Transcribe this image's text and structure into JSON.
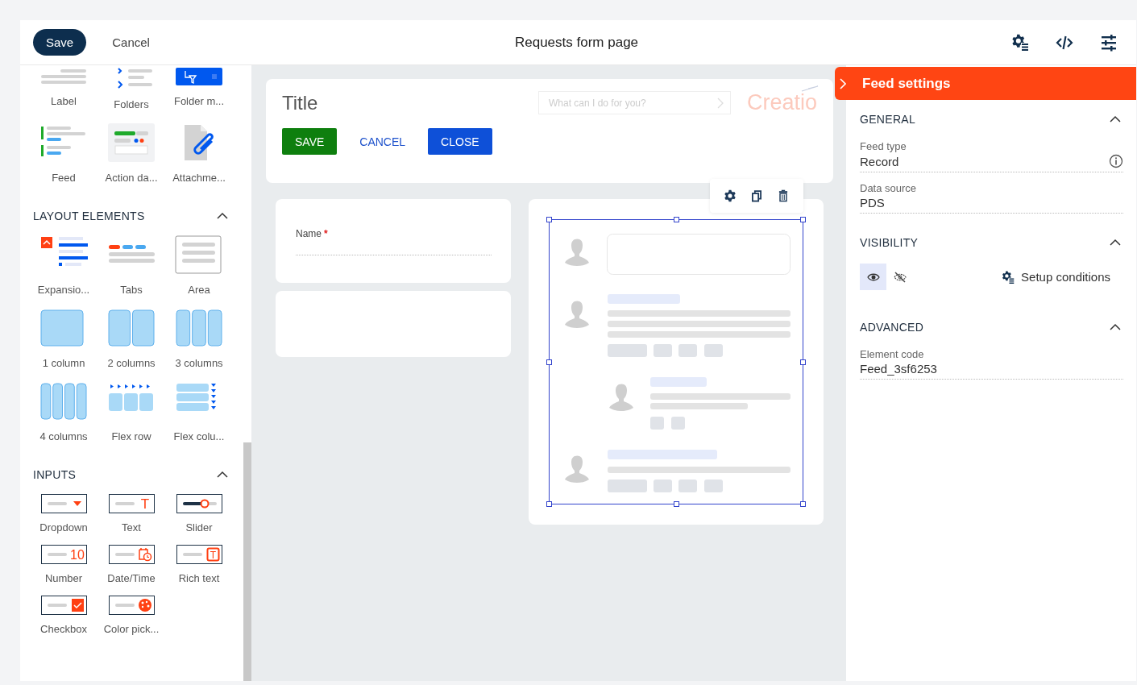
{
  "header": {
    "save": "Save",
    "cancel": "Cancel",
    "title": "Requests form page"
  },
  "palette": [
    {
      "items": [
        {
          "kind": "label",
          "label": "Label"
        },
        {
          "kind": "folders",
          "label": "Folders"
        },
        {
          "kind": "folder-manager",
          "label": "Folder m..."
        },
        {
          "kind": "feed",
          "label": "Feed"
        },
        {
          "kind": "action-dashboard",
          "label": "Action da..."
        },
        {
          "kind": "attachments",
          "label": "Attachme..."
        }
      ]
    },
    {
      "title": "LAYOUT ELEMENTS",
      "expanded": true,
      "items": [
        {
          "kind": "expansion",
          "label": "Expansio..."
        },
        {
          "kind": "tabs",
          "label": "Tabs"
        },
        {
          "kind": "area",
          "label": "Area"
        },
        {
          "kind": "columns1",
          "label": "1 column"
        },
        {
          "kind": "columns2",
          "label": "2 columns"
        },
        {
          "kind": "columns3",
          "label": "3 columns"
        },
        {
          "kind": "columns4",
          "label": "4 columns"
        },
        {
          "kind": "flex-row",
          "label": "Flex row"
        },
        {
          "kind": "flex-column",
          "label": "Flex colu..."
        }
      ]
    },
    {
      "title": "INPUTS",
      "expanded": true,
      "items": [
        {
          "kind": "dropdown",
          "label": "Dropdown"
        },
        {
          "kind": "text",
          "label": "Text",
          "glyph": "T"
        },
        {
          "kind": "slider",
          "label": "Slider"
        },
        {
          "kind": "number",
          "label": "Number",
          "glyph": "10"
        },
        {
          "kind": "datetime",
          "label": "Date/Time"
        },
        {
          "kind": "richtext",
          "label": "Rich text",
          "glyph": "T"
        },
        {
          "kind": "checkbox",
          "label": "Checkbox"
        },
        {
          "kind": "colorpicker",
          "label": "Color pick..."
        }
      ]
    }
  ],
  "page": {
    "title": "Title",
    "search_placeholder": "What can I do for you?",
    "logo": "Creatio",
    "buttons": [
      {
        "label": "SAVE",
        "kind": "green"
      },
      {
        "label": "CANCEL",
        "kind": "link"
      },
      {
        "label": "CLOSE",
        "kind": "blue"
      }
    ],
    "field": {
      "label": "Name",
      "required_mark": "*"
    }
  },
  "settings": {
    "title": "Feed settings",
    "sections": [
      {
        "title": "GENERAL",
        "expanded": true,
        "kind": "fields",
        "fields": [
          {
            "label": "Feed type",
            "value": "Record",
            "info": true
          },
          {
            "label": "Data source",
            "value": "PDS",
            "info": false
          }
        ]
      },
      {
        "title": "VISIBILITY",
        "expanded": true,
        "kind": "visibility",
        "options": [
          {
            "kind": "visible",
            "selected": true
          },
          {
            "kind": "hidden",
            "selected": false
          }
        ],
        "link": "Setup conditions"
      },
      {
        "title": "ADVANCED",
        "expanded": true,
        "kind": "fields",
        "fields": [
          {
            "label": "Element code",
            "value": "Feed_3sf6253",
            "info": false
          }
        ]
      }
    ]
  }
}
